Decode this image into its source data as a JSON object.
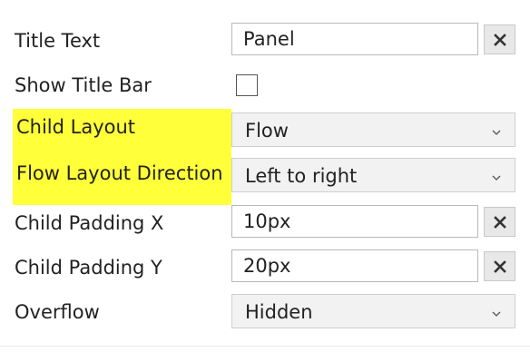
{
  "properties": {
    "title_text": {
      "label": "Title Text",
      "value": "Panel",
      "clear_icon": "close-icon"
    },
    "show_title_bar": {
      "label": "Show Title Bar",
      "checked": false
    },
    "child_layout": {
      "label": "Child Layout",
      "value": "Flow",
      "highlight_color": "#ffff3a",
      "dropdown_icon": "chevron-down-icon"
    },
    "flow_layout_direction": {
      "label": "Flow Layout Direction",
      "value": "Left to right",
      "highlight_color": "#ffff3a",
      "dropdown_icon": "chevron-down-icon"
    },
    "child_padding_x": {
      "label": "Child Padding X",
      "value": "10px",
      "clear_icon": "close-icon"
    },
    "child_padding_y": {
      "label": "Child Padding Y",
      "value": "20px",
      "clear_icon": "close-icon"
    },
    "overflow": {
      "label": "Overflow",
      "value": "Hidden",
      "dropdown_icon": "chevron-down-icon"
    }
  }
}
